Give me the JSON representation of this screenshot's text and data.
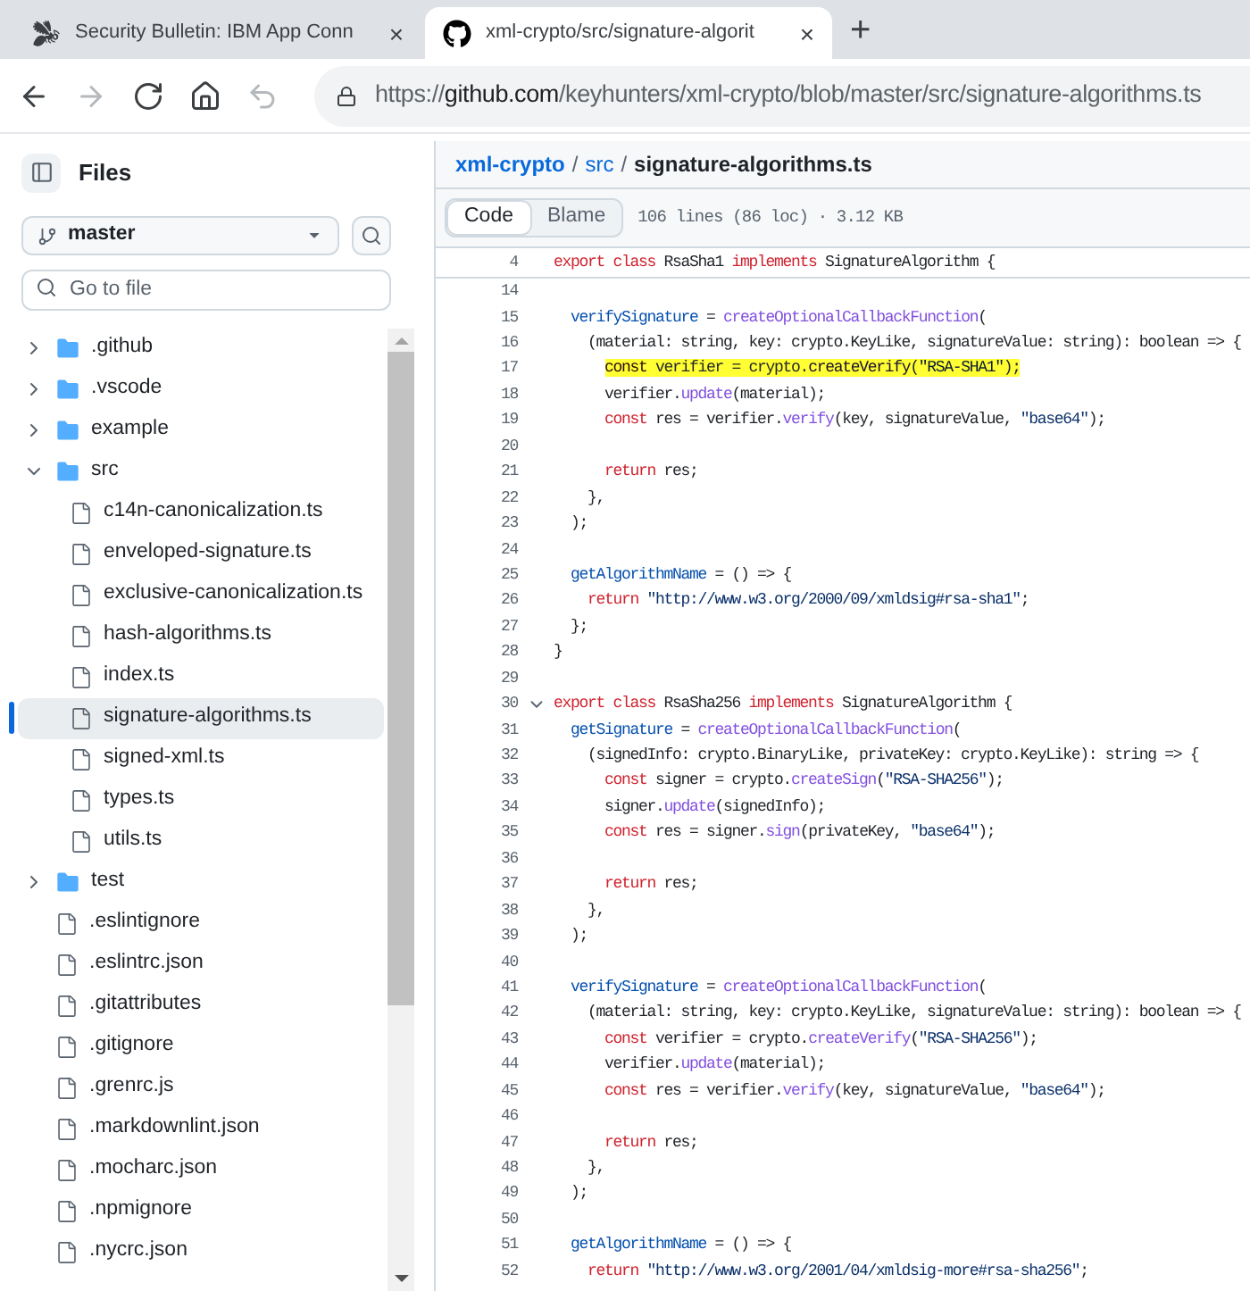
{
  "browser": {
    "tabs": [
      {
        "title": "Security Bulletin: IBM App Conn",
        "kind": "bee",
        "close": "×",
        "selected": false
      },
      {
        "title": "xml-crypto/src/signature-algorit",
        "kind": "github",
        "close": "×",
        "selected": true
      }
    ],
    "new_tab": "+",
    "nav": [
      {
        "kind": "back",
        "disabled": false
      },
      {
        "kind": "forward",
        "disabled": true
      },
      {
        "kind": "reload",
        "disabled": false
      },
      {
        "kind": "home",
        "disabled": false
      },
      {
        "kind": "undo",
        "disabled": true
      }
    ],
    "url": {
      "scheme": "https://",
      "host": "github.com",
      "path": "/keyhunters/xml-crypto/blob/master/src/signature-algorithms.ts"
    }
  },
  "sidebar": {
    "title": "Files",
    "branch": "master",
    "search": {
      "placeholder": "Go to file"
    },
    "tree": [
      {
        "name": ".github",
        "kind": "folder",
        "expanded": false,
        "selected": false
      },
      {
        "name": ".vscode",
        "kind": "folder",
        "expanded": false,
        "selected": false
      },
      {
        "name": "example",
        "kind": "folder",
        "expanded": false,
        "selected": false
      },
      {
        "name": "src",
        "kind": "folder",
        "expanded": true,
        "selected": false,
        "children": [
          {
            "name": "c14n-canonicalization.ts",
            "kind": "file",
            "selected": false
          },
          {
            "name": "enveloped-signature.ts",
            "kind": "file",
            "selected": false
          },
          {
            "name": "exclusive-canonicalization.ts",
            "kind": "file",
            "selected": false
          },
          {
            "name": "hash-algorithms.ts",
            "kind": "file",
            "selected": false
          },
          {
            "name": "index.ts",
            "kind": "file",
            "selected": false
          },
          {
            "name": "signature-algorithms.ts",
            "kind": "file",
            "selected": true
          },
          {
            "name": "signed-xml.ts",
            "kind": "file",
            "selected": false
          },
          {
            "name": "types.ts",
            "kind": "file",
            "selected": false
          },
          {
            "name": "utils.ts",
            "kind": "file",
            "selected": false
          }
        ]
      },
      {
        "name": "test",
        "kind": "folder",
        "expanded": false,
        "selected": false
      },
      {
        "name": ".eslintignore",
        "kind": "file",
        "selected": false
      },
      {
        "name": ".eslintrc.json",
        "kind": "file",
        "selected": false
      },
      {
        "name": ".gitattributes",
        "kind": "file",
        "selected": false
      },
      {
        "name": ".gitignore",
        "kind": "file",
        "selected": false
      },
      {
        "name": ".grenrc.js",
        "kind": "file",
        "selected": false
      },
      {
        "name": ".markdownlint.json",
        "kind": "file",
        "selected": false
      },
      {
        "name": ".mocharc.json",
        "kind": "file",
        "selected": false
      },
      {
        "name": ".npmignore",
        "kind": "file",
        "selected": false
      },
      {
        "name": ".nycrc.json",
        "kind": "file",
        "selected": false
      }
    ]
  },
  "breadcrumb": [
    {
      "kind": "link",
      "text": "xml-crypto"
    },
    {
      "kind": "separator",
      "text": "/"
    },
    {
      "kind": "link",
      "text": "src"
    },
    {
      "kind": "separator",
      "text": "/"
    },
    {
      "kind": "current",
      "text": "signature-algorithms.ts"
    }
  ],
  "view_tabs": [
    {
      "label": "Code",
      "selected": true
    },
    {
      "label": "Blame",
      "selected": false
    }
  ],
  "file_info": "106 lines (86 loc) · 3.12 KB",
  "code": {
    "sticky": {
      "n": "4",
      "fold": false,
      "highlighted": false,
      "tokens": [
        {
          "kind": "kw",
          "text": "export class"
        },
        {
          "kind": "tx",
          "text": " RsaSha1 "
        },
        {
          "kind": "kw",
          "text": "implements"
        },
        {
          "kind": "tx",
          "text": " SignatureAlgorithm {"
        }
      ]
    },
    "lines": [
      {
        "n": "14",
        "fold": false,
        "highlighted": false
      },
      {
        "n": "15",
        "fold": false,
        "highlighted": false,
        "tokens": [
          {
            "kind": "def",
            "text": "  verifySignature"
          },
          {
            "kind": "tx",
            "text": " = "
          },
          {
            "kind": "fn",
            "text": "createOptionalCallbackFunction"
          },
          {
            "kind": "tx",
            "text": "("
          }
        ]
      },
      {
        "n": "16",
        "fold": false,
        "highlighted": false,
        "tokens": [
          {
            "kind": "tx",
            "text": "    (material: string, key: crypto.KeyLike, signatureValue: string): boolean => {"
          }
        ]
      },
      {
        "n": "17",
        "fold": false,
        "highlighted": true,
        "tokens": [
          {
            "kind": "kw",
            "text": "      const"
          },
          {
            "kind": "tx",
            "text": " verifier = crypto."
          },
          {
            "kind": "fn",
            "text": "createVerify"
          },
          {
            "kind": "tx",
            "text": "("
          },
          {
            "kind": "str",
            "text": "\"RSA-SHA1\""
          },
          {
            "kind": "tx",
            "text": ");"
          }
        ]
      },
      {
        "n": "18",
        "fold": false,
        "highlighted": false,
        "tokens": [
          {
            "kind": "tx",
            "text": "      verifier."
          },
          {
            "kind": "fn",
            "text": "update"
          },
          {
            "kind": "tx",
            "text": "(material);"
          }
        ]
      },
      {
        "n": "19",
        "fold": false,
        "highlighted": false,
        "tokens": [
          {
            "kind": "kw",
            "text": "      const"
          },
          {
            "kind": "tx",
            "text": " res = verifier."
          },
          {
            "kind": "fn",
            "text": "verify"
          },
          {
            "kind": "tx",
            "text": "(key, signatureValue, "
          },
          {
            "kind": "str",
            "text": "\"base64\""
          },
          {
            "kind": "tx",
            "text": ");"
          }
        ]
      },
      {
        "n": "20",
        "fold": false,
        "highlighted": false
      },
      {
        "n": "21",
        "fold": false,
        "highlighted": false,
        "tokens": [
          {
            "kind": "kw",
            "text": "      return"
          },
          {
            "kind": "tx",
            "text": " res;"
          }
        ]
      },
      {
        "n": "22",
        "fold": false,
        "highlighted": false,
        "tokens": [
          {
            "kind": "tx",
            "text": "    },"
          }
        ]
      },
      {
        "n": "23",
        "fold": false,
        "highlighted": false,
        "tokens": [
          {
            "kind": "tx",
            "text": "  );"
          }
        ]
      },
      {
        "n": "24",
        "fold": false,
        "highlighted": false
      },
      {
        "n": "25",
        "fold": false,
        "highlighted": false,
        "tokens": [
          {
            "kind": "def",
            "text": "  getAlgorithmName"
          },
          {
            "kind": "tx",
            "text": " = () => {"
          }
        ]
      },
      {
        "n": "26",
        "fold": false,
        "highlighted": false,
        "tokens": [
          {
            "kind": "kw",
            "text": "    return "
          },
          {
            "kind": "str",
            "text": "\"http://www.w3.org/2000/09/xmldsig#rsa-sha1\""
          },
          {
            "kind": "tx",
            "text": ";"
          }
        ]
      },
      {
        "n": "27",
        "fold": false,
        "highlighted": false,
        "tokens": [
          {
            "kind": "tx",
            "text": "  };"
          }
        ]
      },
      {
        "n": "28",
        "fold": false,
        "highlighted": false,
        "tokens": [
          {
            "kind": "tx",
            "text": "}"
          }
        ]
      },
      {
        "n": "29",
        "fold": false,
        "highlighted": false
      },
      {
        "n": "30",
        "fold": true,
        "highlighted": false,
        "tokens": [
          {
            "kind": "kw",
            "text": "export class"
          },
          {
            "kind": "tx",
            "text": " RsaSha256 "
          },
          {
            "kind": "kw",
            "text": "implements"
          },
          {
            "kind": "tx",
            "text": " SignatureAlgorithm {"
          }
        ]
      },
      {
        "n": "31",
        "fold": false,
        "highlighted": false,
        "tokens": [
          {
            "kind": "def",
            "text": "  getSignature"
          },
          {
            "kind": "tx",
            "text": " = "
          },
          {
            "kind": "fn",
            "text": "createOptionalCallbackFunction"
          },
          {
            "kind": "tx",
            "text": "("
          }
        ]
      },
      {
        "n": "32",
        "fold": false,
        "highlighted": false,
        "tokens": [
          {
            "kind": "tx",
            "text": "    (signedInfo: crypto.BinaryLike, privateKey: crypto.KeyLike): string => {"
          }
        ]
      },
      {
        "n": "33",
        "fold": false,
        "highlighted": false,
        "tokens": [
          {
            "kind": "kw",
            "text": "      const"
          },
          {
            "kind": "tx",
            "text": " signer = crypto."
          },
          {
            "kind": "fn",
            "text": "createSign"
          },
          {
            "kind": "tx",
            "text": "("
          },
          {
            "kind": "str",
            "text": "\"RSA-SHA256\""
          },
          {
            "kind": "tx",
            "text": ");"
          }
        ]
      },
      {
        "n": "34",
        "fold": false,
        "highlighted": false,
        "tokens": [
          {
            "kind": "tx",
            "text": "      signer."
          },
          {
            "kind": "fn",
            "text": "update"
          },
          {
            "kind": "tx",
            "text": "(signedInfo);"
          }
        ]
      },
      {
        "n": "35",
        "fold": false,
        "highlighted": false,
        "tokens": [
          {
            "kind": "kw",
            "text": "      const"
          },
          {
            "kind": "tx",
            "text": " res = signer."
          },
          {
            "kind": "fn",
            "text": "sign"
          },
          {
            "kind": "tx",
            "text": "(privateKey, "
          },
          {
            "kind": "str",
            "text": "\"base64\""
          },
          {
            "kind": "tx",
            "text": ");"
          }
        ]
      },
      {
        "n": "36",
        "fold": false,
        "highlighted": false
      },
      {
        "n": "37",
        "fold": false,
        "highlighted": false,
        "tokens": [
          {
            "kind": "kw",
            "text": "      return"
          },
          {
            "kind": "tx",
            "text": " res;"
          }
        ]
      },
      {
        "n": "38",
        "fold": false,
        "highlighted": false,
        "tokens": [
          {
            "kind": "tx",
            "text": "    },"
          }
        ]
      },
      {
        "n": "39",
        "fold": false,
        "highlighted": false,
        "tokens": [
          {
            "kind": "tx",
            "text": "  );"
          }
        ]
      },
      {
        "n": "40",
        "fold": false,
        "highlighted": false
      },
      {
        "n": "41",
        "fold": false,
        "highlighted": false,
        "tokens": [
          {
            "kind": "def",
            "text": "  verifySignature"
          },
          {
            "kind": "tx",
            "text": " = "
          },
          {
            "kind": "fn",
            "text": "createOptionalCallbackFunction"
          },
          {
            "kind": "tx",
            "text": "("
          }
        ]
      },
      {
        "n": "42",
        "fold": false,
        "highlighted": false,
        "tokens": [
          {
            "kind": "tx",
            "text": "    (material: string, key: crypto.KeyLike, signatureValue: string): boolean => {"
          }
        ]
      },
      {
        "n": "43",
        "fold": false,
        "highlighted": false,
        "tokens": [
          {
            "kind": "kw",
            "text": "      const"
          },
          {
            "kind": "tx",
            "text": " verifier = crypto."
          },
          {
            "kind": "fn",
            "text": "createVerify"
          },
          {
            "kind": "tx",
            "text": "("
          },
          {
            "kind": "str",
            "text": "\"RSA-SHA256\""
          },
          {
            "kind": "tx",
            "text": ");"
          }
        ]
      },
      {
        "n": "44",
        "fold": false,
        "highlighted": false,
        "tokens": [
          {
            "kind": "tx",
            "text": "      verifier."
          },
          {
            "kind": "fn",
            "text": "update"
          },
          {
            "kind": "tx",
            "text": "(material);"
          }
        ]
      },
      {
        "n": "45",
        "fold": false,
        "highlighted": false,
        "tokens": [
          {
            "kind": "kw",
            "text": "      const"
          },
          {
            "kind": "tx",
            "text": " res = verifier."
          },
          {
            "kind": "fn",
            "text": "verify"
          },
          {
            "kind": "tx",
            "text": "(key, signatureValue, "
          },
          {
            "kind": "str",
            "text": "\"base64\""
          },
          {
            "kind": "tx",
            "text": ");"
          }
        ]
      },
      {
        "n": "46",
        "fold": false,
        "highlighted": false
      },
      {
        "n": "47",
        "fold": false,
        "highlighted": false,
        "tokens": [
          {
            "kind": "kw",
            "text": "      return"
          },
          {
            "kind": "tx",
            "text": " res;"
          }
        ]
      },
      {
        "n": "48",
        "fold": false,
        "highlighted": false,
        "tokens": [
          {
            "kind": "tx",
            "text": "    },"
          }
        ]
      },
      {
        "n": "49",
        "fold": false,
        "highlighted": false,
        "tokens": [
          {
            "kind": "tx",
            "text": "  );"
          }
        ]
      },
      {
        "n": "50",
        "fold": false,
        "highlighted": false
      },
      {
        "n": "51",
        "fold": false,
        "highlighted": false,
        "tokens": [
          {
            "kind": "def",
            "text": "  getAlgorithmName"
          },
          {
            "kind": "tx",
            "text": " = () => {"
          }
        ]
      },
      {
        "n": "52",
        "fold": false,
        "highlighted": false,
        "tokens": [
          {
            "kind": "kw",
            "text": "    return "
          },
          {
            "kind": "str",
            "text": "\"http://www.w3.org/2001/04/xmldsig-more#rsa-sha256\""
          },
          {
            "kind": "tx",
            "text": ";"
          }
        ]
      }
    ]
  }
}
